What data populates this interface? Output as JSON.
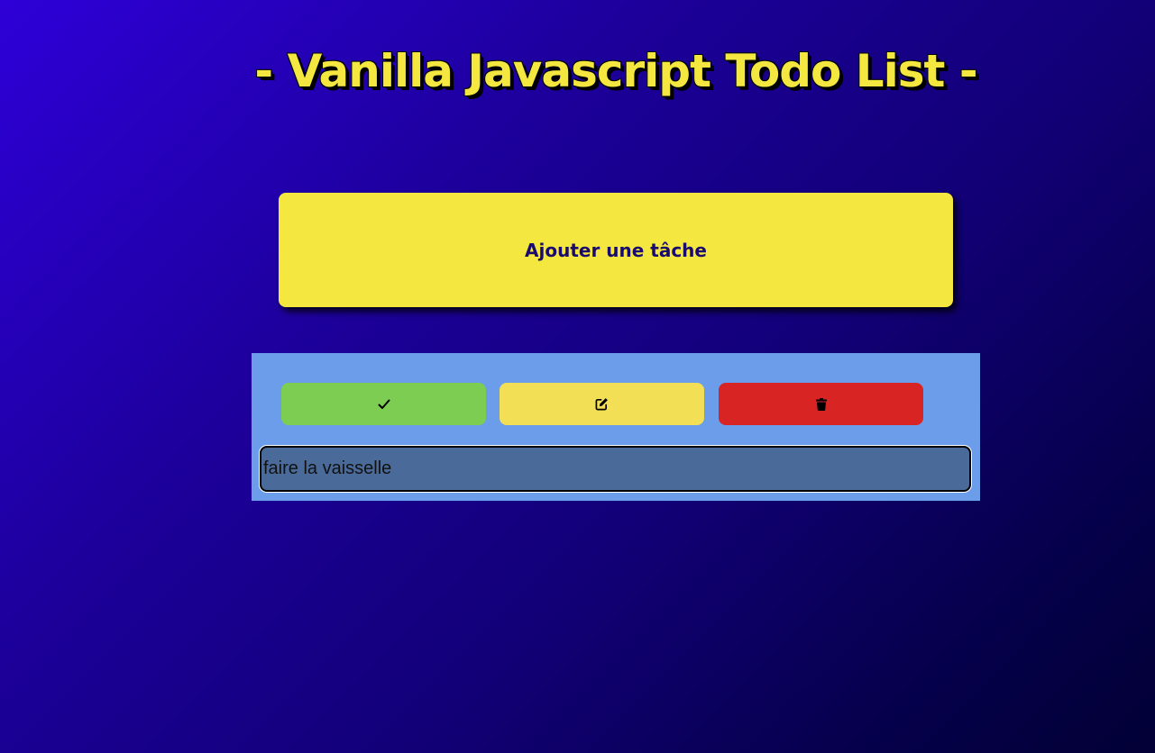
{
  "header": {
    "title": "- Vanilla Javascript Todo List -"
  },
  "add_task": {
    "label": "Ajouter une tâche"
  },
  "todo_item": {
    "text": "faire la vaisselle",
    "actions": [
      {
        "name": "complete",
        "icon": "check-icon",
        "color": "#7dcd52"
      },
      {
        "name": "edit",
        "icon": "edit-icon",
        "color": "#f2df55"
      },
      {
        "name": "delete",
        "icon": "trash-icon",
        "color": "#d92424"
      }
    ]
  },
  "colors": {
    "accent_yellow": "#f4e840",
    "panel_blue": "#6b9deb",
    "input_blue": "#4a6b9a",
    "background_start": "#2e00d8",
    "background_end": "#020035"
  }
}
